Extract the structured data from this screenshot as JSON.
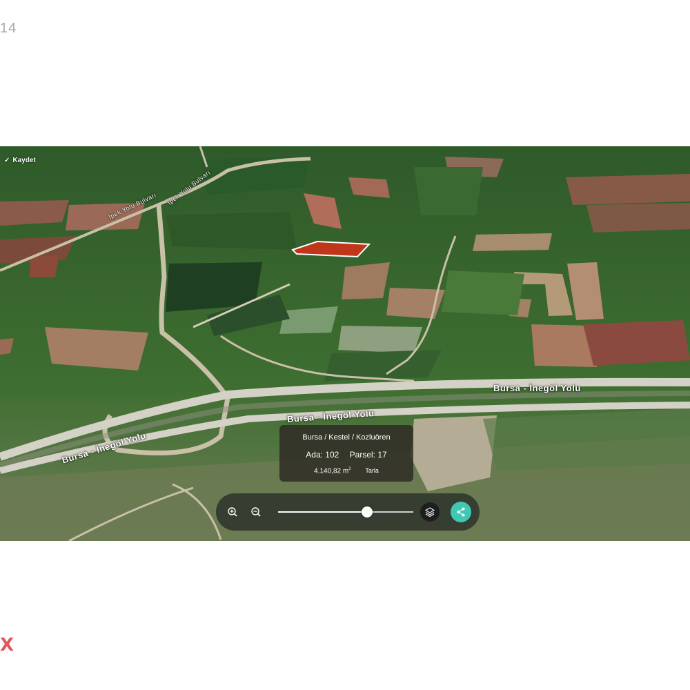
{
  "page": {
    "corner_number": "14",
    "corner_mark": "X"
  },
  "map": {
    "save_label": "Kaydet",
    "road_labels": {
      "highway_right": "Bursa - İnegöl Yolu",
      "highway_center": "Bursa - İnegöl Yolu",
      "highway_left": "Bursa - İnegöl Yolu",
      "street_upper": "İpek Yolu Bulvarı",
      "street_lower": "İpek Yolu Bulvarı"
    },
    "parcel_color": "#c0361b",
    "info_card": {
      "location": "Bursa / Kestel / Kozluören",
      "ada_label": "Ada: 102",
      "parsel_label": "Parsel: 17",
      "area": "4.140,82 m",
      "area_unit_sup": "2",
      "land_type": "Tarla"
    },
    "controls": {
      "zoom_in_icon": "zoom-in-icon",
      "zoom_out_icon": "zoom-out-icon",
      "slider_level": 0.66,
      "layers_icon": "layers-icon",
      "share_icon": "share-icon",
      "share_color": "#3fc8b2"
    }
  }
}
